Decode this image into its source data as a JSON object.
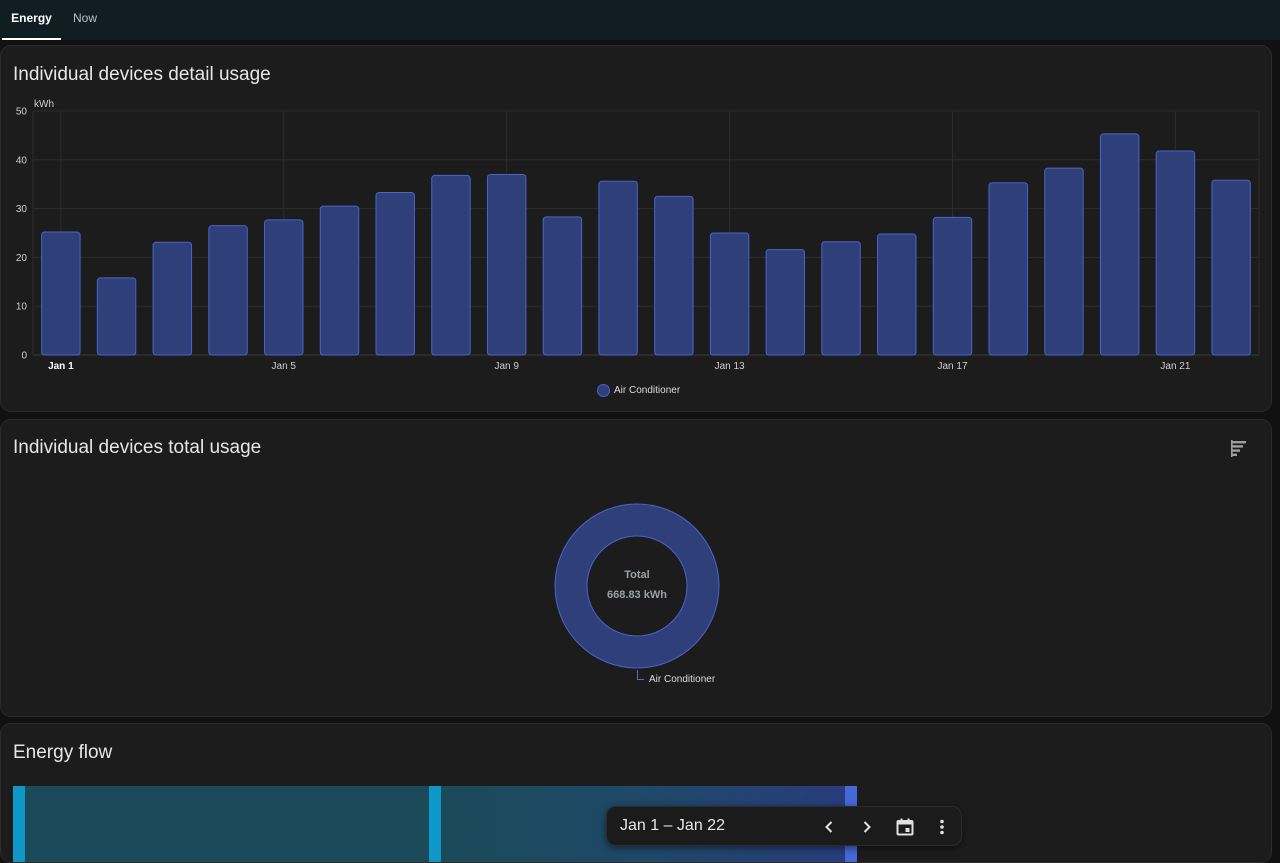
{
  "tabs": [
    {
      "label": "Energy",
      "active": true
    },
    {
      "label": "Now",
      "active": false
    }
  ],
  "detail_card": {
    "title": "Individual devices detail usage"
  },
  "chart_data": [
    {
      "type": "bar",
      "title": "",
      "ylabel": "kWh",
      "xlabel": "",
      "ylim": [
        0,
        50
      ],
      "yticks": [
        0,
        10,
        20,
        30,
        40,
        50
      ],
      "categories": [
        "Jan 1",
        "Jan 2",
        "Jan 3",
        "Jan 4",
        "Jan 5",
        "Jan 6",
        "Jan 7",
        "Jan 8",
        "Jan 9",
        "Jan 10",
        "Jan 11",
        "Jan 12",
        "Jan 13",
        "Jan 14",
        "Jan 15",
        "Jan 16",
        "Jan 17",
        "Jan 18",
        "Jan 19",
        "Jan 20",
        "Jan 21",
        "Jan 22"
      ],
      "xtick_labels": [
        "Jan 1",
        "Jan 5",
        "Jan 9",
        "Jan 13",
        "Jan 17",
        "Jan 21"
      ],
      "series": [
        {
          "name": "Air Conditioner",
          "values": [
            25.2,
            15.8,
            23.1,
            26.5,
            27.7,
            30.5,
            33.3,
            36.8,
            37.0,
            28.3,
            35.6,
            32.5,
            25.0,
            21.6,
            23.2,
            24.8,
            28.2,
            35.3,
            38.3,
            45.3,
            41.8,
            35.8
          ]
        }
      ],
      "legend": "bottom-center",
      "grid": true
    },
    {
      "type": "pie",
      "title": "",
      "categories": [
        "Air Conditioner"
      ],
      "values": [
        668.83
      ],
      "center_label": "Total",
      "center_value": "668.83 kWh"
    }
  ],
  "legend_label": "Air Conditioner",
  "total_card": {
    "title": "Individual devices total usage",
    "sort_icon": "sort-bars-icon",
    "total_label": "Total",
    "total_value": "668.83 kWh",
    "callout_label": "Air Conditioner"
  },
  "flow_card": {
    "title": "Energy flow"
  },
  "date_picker": {
    "range": "Jan 1 – Jan 22",
    "prev_icon": "chevron-left-icon",
    "next_icon": "chevron-right-icon",
    "calendar_icon": "calendar-icon",
    "more_icon": "more-vert-icon"
  },
  "colors": {
    "bar_fill": "#2f3f7a",
    "bar_stroke": "#4a64c8",
    "card_bg": "#1c1c1c",
    "flow_node": "#0e98c8",
    "flow_node_end": "#4468d8"
  }
}
